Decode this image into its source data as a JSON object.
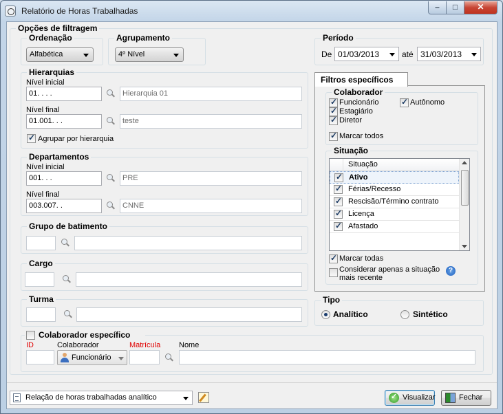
{
  "window": {
    "title": "Relatório de Horas Trabalhadas",
    "controls": {
      "minimize": "–",
      "maximize": "□",
      "close": "✕"
    }
  },
  "filters": {
    "title": "Opções de filtragem",
    "ordenacao": {
      "label": "Ordenação",
      "value": "Alfabética"
    },
    "agrupamento": {
      "label": "Agrupamento",
      "value": "4º Nível"
    },
    "periodo": {
      "label": "Período",
      "from_label": "De",
      "from": "01/03/2013",
      "to_label": "até",
      "to": "31/03/2013"
    },
    "hierarquias": {
      "label": "Hierarquias",
      "inicial_label": "Nível inicial",
      "inicial_code": "01.  .  .  .",
      "inicial_desc": "Hierarquia 01",
      "final_label": "Nível final",
      "final_code": "01.001.  .  .",
      "final_desc": "teste",
      "agrupar_label": "Agrupar por hierarquia",
      "agrupar_checked": true
    },
    "departamentos": {
      "label": "Departamentos",
      "inicial_label": "Nível inicial",
      "inicial_code": "001.  .  .",
      "inicial_desc": "PRE",
      "final_label": "Nível final",
      "final_code": "003.007.  .",
      "final_desc": "CNNE"
    },
    "grupo_batimento": {
      "label": "Grupo de batimento",
      "code": "",
      "desc": ""
    },
    "cargo": {
      "label": "Cargo",
      "code": "",
      "desc": ""
    },
    "turma": {
      "label": "Turma",
      "code": "",
      "desc": ""
    },
    "colaborador_especifico": {
      "label": "Colaborador específico",
      "checked": false,
      "id_label": "ID",
      "colaborador_label": "Colaborador",
      "matricula_label": "Matrícula",
      "nome_label": "Nome",
      "colaborador_value": "Funcionário",
      "id_value": "",
      "matricula_value": "",
      "nome_value": ""
    }
  },
  "filtros_especificos": {
    "tab_label": "Filtros específicos",
    "colaborador": {
      "label": "Colaborador",
      "funcionario": "Funcionário",
      "autonomo": "Autônomo",
      "estagiario": "Estagiário",
      "diretor": "Diretor",
      "marcar_todos": "Marcar todos"
    },
    "situacao": {
      "label": "Situação",
      "column": "Situação",
      "rows": [
        "Ativo",
        "Férias/Recesso",
        "Rescisão/Término contrato",
        "Licença",
        "Afastado"
      ],
      "marcar_todas": "Marcar todas",
      "considerar_line1": "Considerar apenas a situação",
      "considerar_line2": "mais recente"
    }
  },
  "tipo": {
    "label": "Tipo",
    "analitico": "Analítico",
    "sintetico": "Sintético",
    "selected": "Analítico"
  },
  "footer": {
    "report": "Relação de horas trabalhadas analítico",
    "visualizar": "Visualizar",
    "fechar": "Fechar"
  },
  "colors": {
    "accent_required": "#e00000",
    "selected_row_border": "#7aa0d0"
  }
}
